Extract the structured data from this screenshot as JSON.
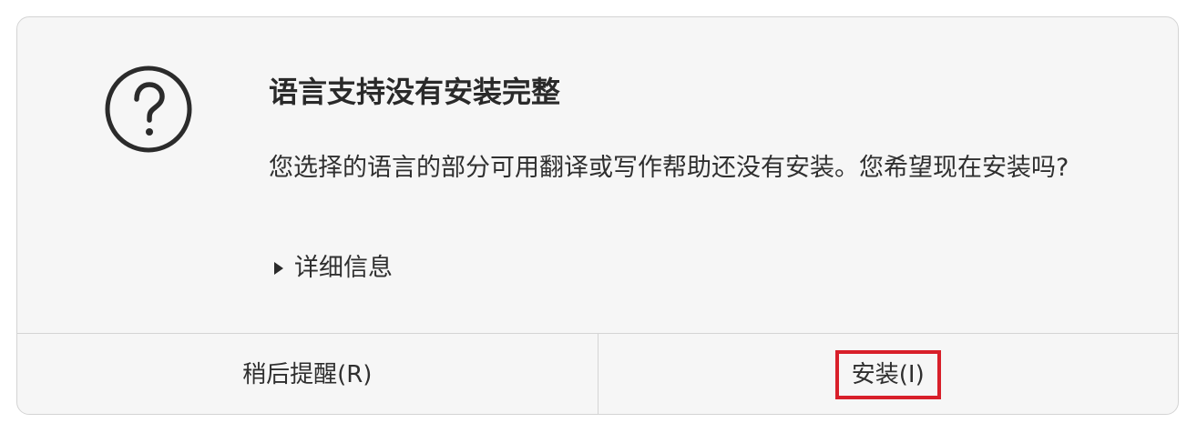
{
  "dialog": {
    "title": "语言支持没有安装完整",
    "message": "您选择的语言的部分可用翻译或写作帮助还没有安装。您希望现在安装吗?",
    "details_label": "详细信息",
    "icon": "question-circle-icon",
    "expander_icon": "triangle-right-icon"
  },
  "buttons": {
    "remind_label": "稍后提醒(R)",
    "install_label": "安装(I)"
  },
  "colors": {
    "dialog_bg": "#f6f6f6",
    "border": "#d4d4d4",
    "text": "#2f2f2f",
    "highlight": "#d81f2a"
  }
}
